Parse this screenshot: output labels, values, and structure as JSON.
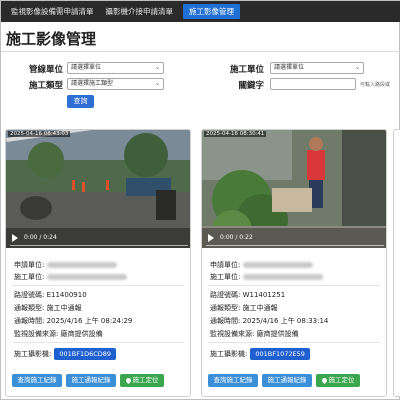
{
  "nav": {
    "items": [
      {
        "label": "監視影像設備需申請清單",
        "active": false
      },
      {
        "label": "攝影機介接申請清單",
        "active": false
      },
      {
        "label": "施工影像管理",
        "active": true
      }
    ]
  },
  "page_title": "施工影像管理",
  "filters": {
    "unit_label": "管線單位",
    "unit_value": "請選擇單位",
    "type_label": "施工類型",
    "type_value": "請選擇施工類型",
    "construct_unit_label": "施工單位",
    "construct_unit_value": "請選擇單位",
    "keyword_label": "關鍵字",
    "keyword_placeholder": "",
    "keyword_hint": "可輸入路段或",
    "query_button": "查詢"
  },
  "cards": [
    {
      "video_timestamp": "2025-04-16 08:43:03",
      "video_time": "0:00 / 0:24",
      "apply_unit_label": "申請單位:",
      "construct_unit_label": "施工單位:",
      "case_label": "路證號碼:",
      "case_value": "E11400910",
      "notify_type_label": "通報類型:",
      "notify_type_value": "施工中通報",
      "notify_time_label": "通報時間:",
      "notify_time_value": "2025/4/16 上午 08:24:29",
      "provider_label": "監視設備來源:",
      "provider_value": "廠商提供設備",
      "camera_label": "施工攝影機:",
      "camera_value": "001BF1D6CD89",
      "btn_record": "查詢施工紀錄",
      "btn_report": "施工通報紀錄",
      "btn_location": "施工定位"
    },
    {
      "video_timestamp": "2025-04-16 08:30:41",
      "video_time": "0:00 / 0:22",
      "apply_unit_label": "申請單位:",
      "construct_unit_label": "施工單位:",
      "case_label": "路證號碼:",
      "case_value": "W11401251",
      "notify_type_label": "通報類型:",
      "notify_type_value": "施工中通報",
      "notify_time_label": "通報時間:",
      "notify_time_value": "2025/4/16 上午 08:33:14",
      "provider_label": "監視設備來源:",
      "provider_value": "廠商提供設備",
      "camera_label": "施工攝影機:",
      "camera_value": "001BF1072E59",
      "btn_record": "查詢施工紀錄",
      "btn_report": "施工通報紀錄",
      "btn_location": "施工定位"
    }
  ],
  "colors": {
    "nav_bg": "#2a2a2a",
    "nav_active": "#1f6fd6",
    "primary_button": "#2f6fd4",
    "chip": "#1f5fd0",
    "action_blue": "#3a8fd8",
    "action_green": "#3aa64e"
  }
}
